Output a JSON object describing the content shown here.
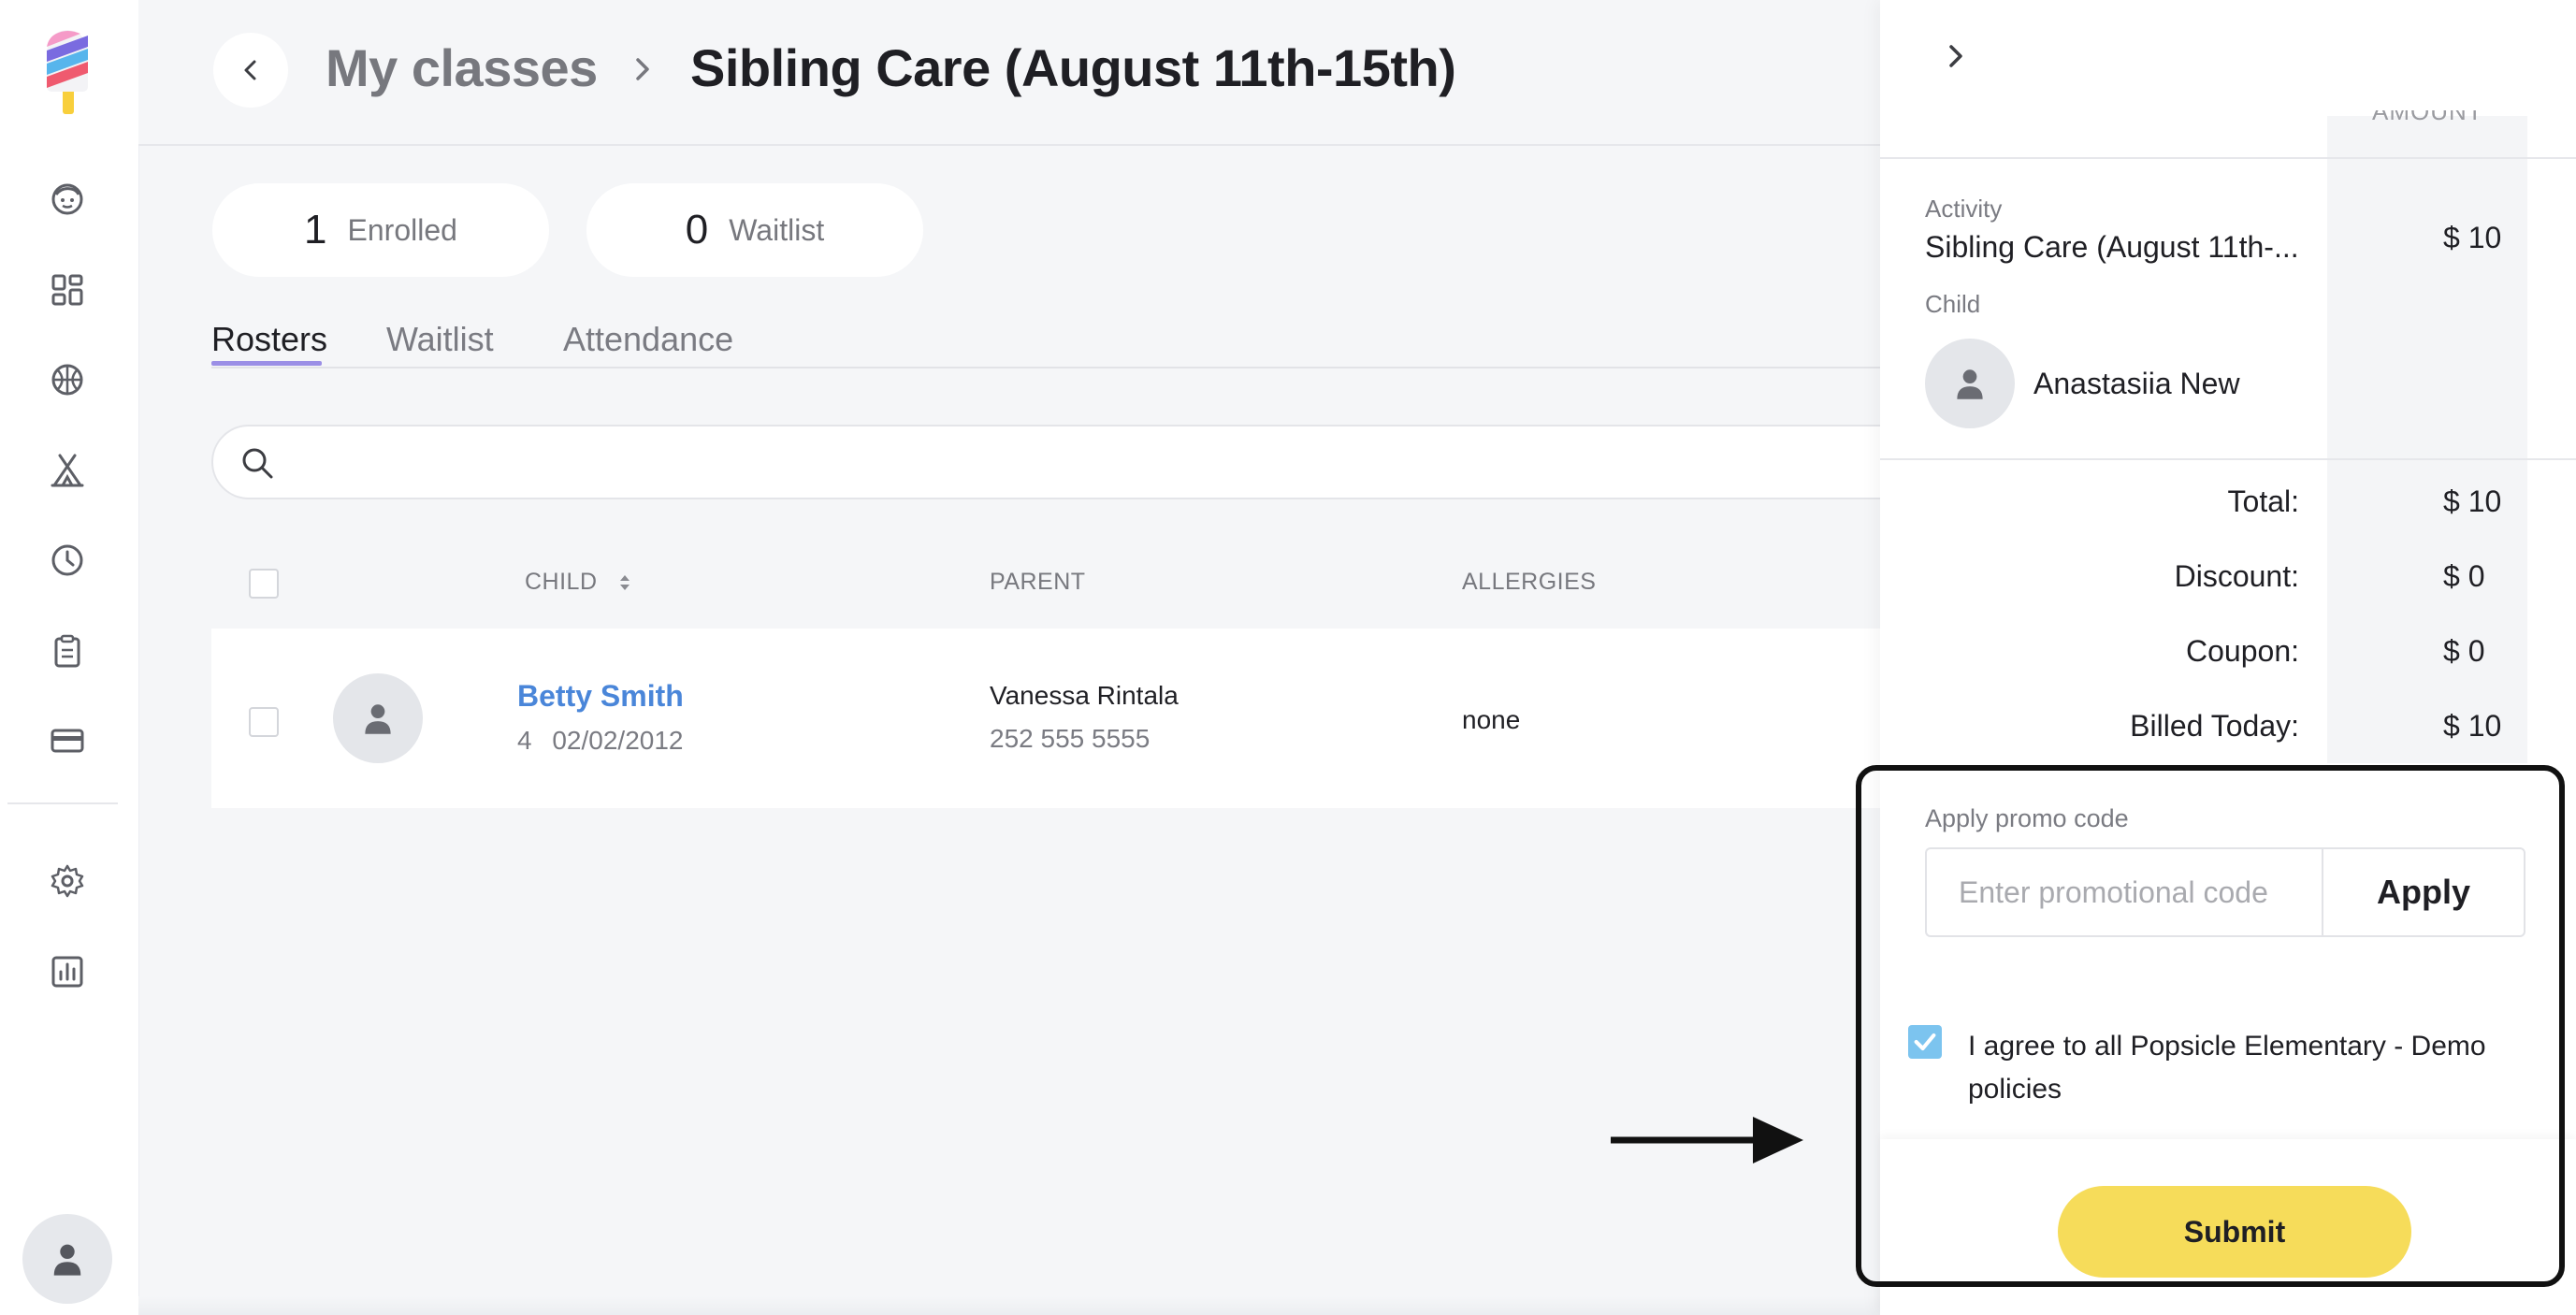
{
  "header": {
    "breadcrumb_parent": "My classes",
    "breadcrumb_current": "Sibling Care (August 11th-15th)"
  },
  "stats": {
    "enrolled": {
      "count": "1",
      "label": "Enrolled"
    },
    "waitlist": {
      "count": "0",
      "label": "Waitlist"
    }
  },
  "tabs": [
    {
      "label": "Rosters",
      "active": true
    },
    {
      "label": "Waitlist",
      "active": false
    },
    {
      "label": "Attendance",
      "active": false
    }
  ],
  "search": {
    "placeholder": ""
  },
  "table": {
    "headers": {
      "child": "CHILD",
      "parent": "PARENT",
      "allergies": "ALLERGIES"
    },
    "rows": [
      {
        "child_name": "Betty Smith",
        "child_meta": "4 02/02/2012",
        "parent_name": "Vanessa Rintala",
        "parent_phone": "252 555 5555",
        "allergies": "none"
      }
    ]
  },
  "panel": {
    "amount_header": "AMOUNT",
    "activity_label": "Activity",
    "activity_name": "Sibling Care (August 11th-...",
    "activity_amount": "$ 10",
    "child_label": "Child",
    "child_name": "Anastasiia New",
    "summary": [
      {
        "label": "Total:",
        "value": "$ 10"
      },
      {
        "label": "Discount:",
        "value": "$ 0"
      },
      {
        "label": "Coupon:",
        "value": "$ 0"
      },
      {
        "label": "Billed Today:",
        "value": "$ 10"
      }
    ],
    "promo": {
      "label": "Apply promo code",
      "placeholder": "Enter promotional code",
      "apply_label": "Apply"
    },
    "agree": {
      "checked": true,
      "text": "I agree to all Popsicle Elementary - Demo policies"
    },
    "submit_label": "Submit"
  },
  "colors": {
    "accent_tab": "#9b8fe6",
    "link": "#4a86d9",
    "submit": "#f6dc5a",
    "checkbox": "#7cc4ef"
  },
  "icons": {
    "nav": [
      "popsicle-logo",
      "child-face-icon",
      "dashboard-icon",
      "sports-ball-icon",
      "camp-tent-icon",
      "clock-icon",
      "clipboard-icon",
      "credit-card-icon",
      "gear-icon",
      "report-chart-icon",
      "user-avatar-icon"
    ]
  }
}
